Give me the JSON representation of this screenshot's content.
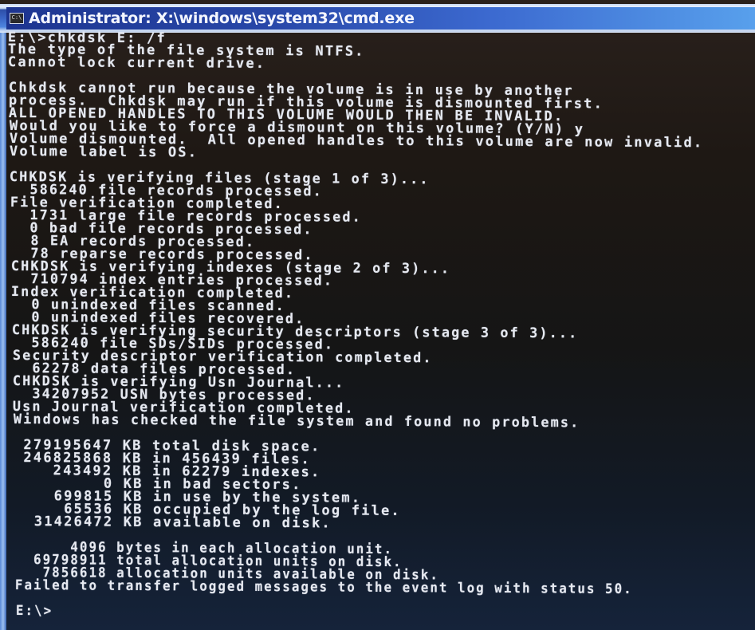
{
  "window": {
    "title": "Administrator: X:\\windows\\system32\\cmd.exe",
    "icon": "cmd-prompt-icon",
    "icon_glyph": "C:\\"
  },
  "console": {
    "lines": [
      "E:\\>chkdsk E: /f",
      "The type of the file system is NTFS.",
      "Cannot lock current drive.",
      "",
      "Chkdsk cannot run because the volume is in use by another",
      "process.  Chkdsk may run if this volume is dismounted first.",
      "ALL OPENED HANDLES TO THIS VOLUME WOULD THEN BE INVALID.",
      "Would you like to force a dismount on this volume? (Y/N) y",
      "Volume dismounted.  All opened handles to this volume are now invalid.",
      "Volume label is OS.",
      "",
      "CHKDSK is verifying files (stage 1 of 3)...",
      "  586240 file records processed.",
      "File verification completed.",
      "  1731 large file records processed.",
      "  0 bad file records processed.",
      "  8 EA records processed.",
      "  78 reparse records processed.",
      "CHKDSK is verifying indexes (stage 2 of 3)...",
      "  710794 index entries processed.",
      "Index verification completed.",
      "  0 unindexed files scanned.",
      "  0 unindexed files recovered.",
      "CHKDSK is verifying security descriptors (stage 3 of 3)...",
      "  586240 file SDs/SIDs processed.",
      "Security descriptor verification completed.",
      "  62278 data files processed.",
      "CHKDSK is verifying Usn Journal...",
      "  34207952 USN bytes processed.",
      "Usn Journal verification completed.",
      "Windows has checked the file system and found no problems.",
      "",
      " 279195647 KB total disk space.",
      " 246825868 KB in 456439 files.",
      "    243492 KB in 62279 indexes.",
      "         0 KB in bad sectors.",
      "    699815 KB in use by the system.",
      "     65536 KB occupied by the log file.",
      "  31426472 KB available on disk.",
      "",
      "      4096 bytes in each allocation unit.",
      "  69798911 total allocation units on disk.",
      "   7856618 allocation units available on disk.",
      "Failed to transfer logged messages to the event log with status 50.",
      "",
      "E:\\>"
    ]
  }
}
